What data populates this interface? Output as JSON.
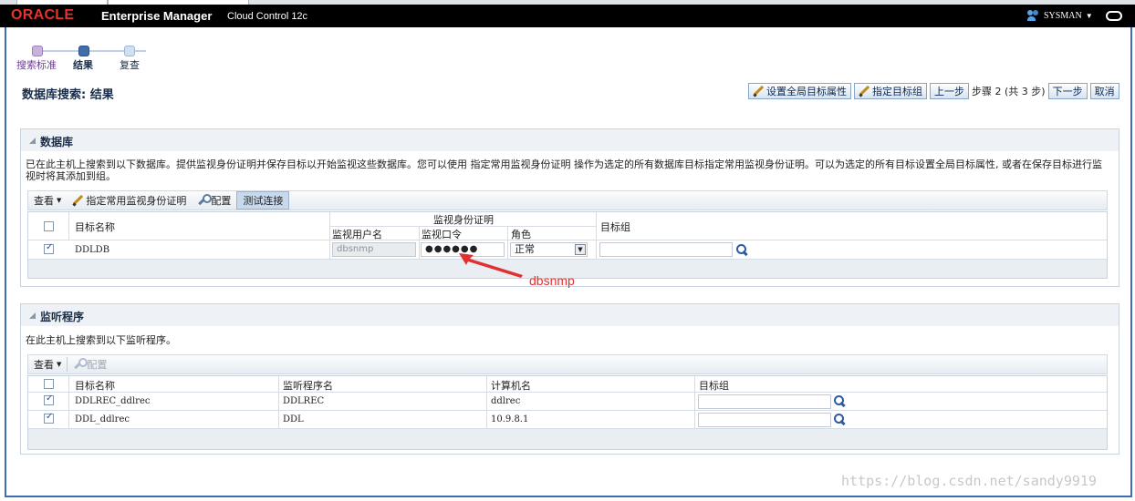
{
  "header": {
    "logo_text": "ORACLE",
    "product": "Enterprise Manager",
    "edition": "Cloud Control 12c",
    "user": "SYSMAN"
  },
  "train": {
    "steps": [
      {
        "label": "搜索标准",
        "state": "visited"
      },
      {
        "label": "结果",
        "state": "current"
      },
      {
        "label": "复查",
        "state": "next"
      }
    ]
  },
  "page": {
    "title": "数据库搜索: 结果"
  },
  "actions": {
    "set_global": "设置全局目标属性",
    "set_group": "指定目标组",
    "prev": "上一步",
    "step_text": "步骤 2 (共 3 步)",
    "next": "下一步",
    "cancel": "取消"
  },
  "db_section": {
    "title": "数据库",
    "description": "已在此主机上搜索到以下数据库。提供监视身份证明并保存目标以开始监视这些数据库。您可以使用 指定常用监视身份证明 操作为选定的所有数据库目标指定常用监视身份证明。可以为选定的所有目标设置全局目标属性, 或者在保存目标进行监视时将其添加到组。",
    "toolbar": {
      "view": "查看",
      "set_creds": "指定常用监视身份证明",
      "config": "配置",
      "test": "测试连接"
    },
    "columns": {
      "name": "目标名称",
      "cred_group": "监视身份证明",
      "user": "监视用户名",
      "password": "监视口令",
      "role": "角色",
      "group": "目标组"
    },
    "rows": [
      {
        "name": "DDLDB",
        "user": "dbsnmp",
        "password": "●●●●●●",
        "role": "正常",
        "checked": true
      }
    ]
  },
  "annotation": "dbsnmp",
  "listener_section": {
    "title": "监听程序",
    "description": "在此主机上搜索到以下监听程序。",
    "toolbar": {
      "view": "查看",
      "config": "配置"
    },
    "columns": {
      "name": "目标名称",
      "listener": "监听程序名",
      "host": "计算机名",
      "group": "目标组"
    },
    "rows": [
      {
        "name": "DDLREC_ddlrec",
        "listener": "DDLREC",
        "host": "ddlrec",
        "checked": true
      },
      {
        "name": "DDL_ddlrec",
        "listener": "DDL",
        "host": "10.9.8.1",
        "checked": true
      }
    ]
  },
  "watermark": "https://blog.csdn.net/sandy9919"
}
